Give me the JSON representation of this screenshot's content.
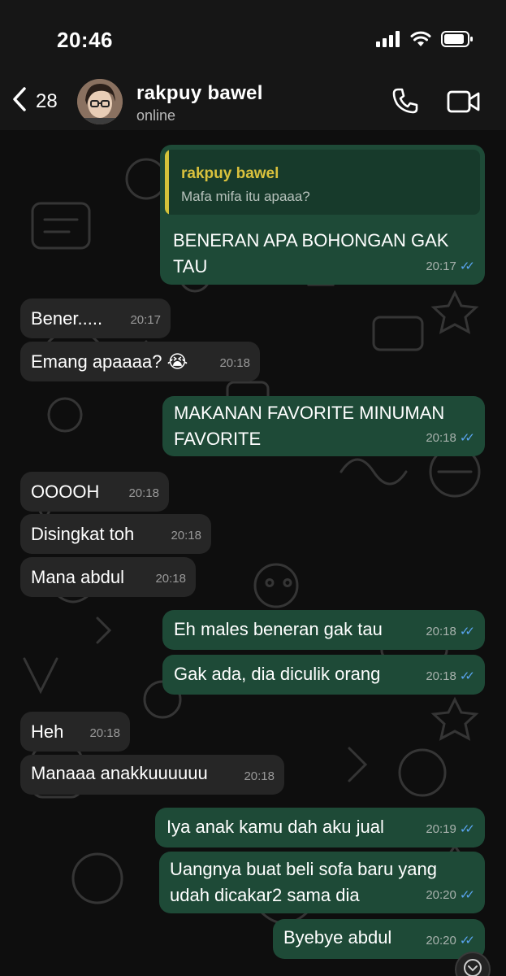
{
  "status_bar": {
    "time": "20:46"
  },
  "header": {
    "back_count": "28",
    "contact_name": "rakpuy bawel",
    "contact_status": "online"
  },
  "messages": [
    {
      "dir": "out",
      "quote_name": "rakpuy bawel",
      "quote_text": "Mafa mifa itu apaaa?",
      "text": "BENERAN APA BOHONGAN GAK TAU",
      "time": "20:17"
    },
    {
      "dir": "in",
      "text": "Bener.....",
      "time": "20:17"
    },
    {
      "dir": "in",
      "text": "Emang apaaaa? 😭",
      "time": "20:18"
    },
    {
      "dir": "out",
      "text": "MAKANAN FAVORITE MINUMAN FAVORITE",
      "time": "20:18"
    },
    {
      "dir": "in",
      "text": "OOOOH",
      "time": "20:18"
    },
    {
      "dir": "in",
      "text": "Disingkat toh",
      "time": "20:18"
    },
    {
      "dir": "in",
      "text": "Mana abdul",
      "time": "20:18"
    },
    {
      "dir": "out",
      "text": "Eh males beneran gak tau",
      "time": "20:18"
    },
    {
      "dir": "out",
      "text": "Gak ada, dia diculik orang",
      "time": "20:18"
    },
    {
      "dir": "in",
      "text": "Heh",
      "time": "20:18"
    },
    {
      "dir": "in",
      "text": "Manaaa anakkuuuuuu",
      "time": "20:18"
    },
    {
      "dir": "out",
      "text": "Iya anak kamu dah aku jual",
      "time": "20:19"
    },
    {
      "dir": "out",
      "text": "Uangnya buat beli sofa baru yang udah dicakar2 sama dia",
      "time": "20:20"
    },
    {
      "dir": "out",
      "text": "Byebye abdul",
      "time": "20:20"
    }
  ],
  "colors": {
    "outgoing_bubble": "#1e4a37",
    "incoming_bubble": "#262626",
    "read_ticks": "#5aa4f0",
    "quote_accent": "#d4c23a"
  },
  "icons": {
    "back": "chevron-left-icon",
    "call": "phone-icon",
    "video": "video-camera-icon",
    "signal": "signal-icon",
    "wifi": "wifi-icon",
    "battery": "battery-icon",
    "scroll_down": "chevron-down-icon",
    "read_receipt": "double-check-icon"
  }
}
